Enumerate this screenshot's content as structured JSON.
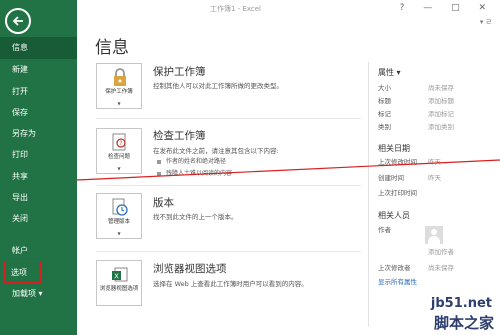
{
  "window": {
    "title": "工作簿1 - Excel",
    "controls": "? — □ ✕",
    "user": "▾ ㄹ"
  },
  "sidebar": {
    "items": [
      {
        "label": "信息",
        "active": true
      },
      {
        "label": "新建"
      },
      {
        "label": "打开"
      },
      {
        "label": "保存"
      },
      {
        "label": "另存为"
      },
      {
        "label": "打印"
      },
      {
        "label": "共享"
      },
      {
        "label": "导出"
      },
      {
        "label": "关闭"
      },
      {
        "label": "帐户"
      },
      {
        "label": "选项"
      },
      {
        "label": "加载项 ▾"
      }
    ]
  },
  "main": {
    "title": "信息",
    "sections": {
      "protect": {
        "tile": "保护工作簿",
        "title": "保护工作簿",
        "desc": "控制其他人可以对此工作簿所做的更改类型。"
      },
      "inspect": {
        "tile": "检查问题",
        "title": "检查工作簿",
        "desc": "在发布此文件之前，请注意其包含以下内容:",
        "bullets": [
          "作者的姓名和绝对路径",
          "残障人士难以阅读的内容"
        ]
      },
      "versions": {
        "tile": "管理版本",
        "title": "版本",
        "desc": "找不到此文件的上一个版本。"
      },
      "browser": {
        "tile": "浏览器视图选项",
        "title": "浏览器视图选项",
        "desc": "选择在 Web 上查看此工作簿时用户可以看到的内容。"
      }
    }
  },
  "properties": {
    "header": "属性 ▾",
    "rows": [
      {
        "k": "大小",
        "v": "尚未保存"
      },
      {
        "k": "标题",
        "v": "添加标题"
      },
      {
        "k": "标记",
        "v": "添加标记"
      },
      {
        "k": "类别",
        "v": "添加类别"
      }
    ],
    "dates_header": "相关日期",
    "dates": [
      {
        "k": "上次修改时间",
        "v": "昨天"
      },
      {
        "k": "创建时间",
        "v": "昨天"
      },
      {
        "k": "上次打印时间",
        "v": ""
      }
    ],
    "people_header": "相关人员",
    "author_label": "作者",
    "add_author": "添加作者",
    "last_modified_by_label": "上次修改者",
    "last_modified_by": "尚未保存",
    "show_all": "显示所有属性"
  },
  "watermark": {
    "site": "jb51.net",
    "brand": "脚本之家"
  },
  "colors": {
    "accent": "#217346",
    "highlight": "#d92020"
  }
}
